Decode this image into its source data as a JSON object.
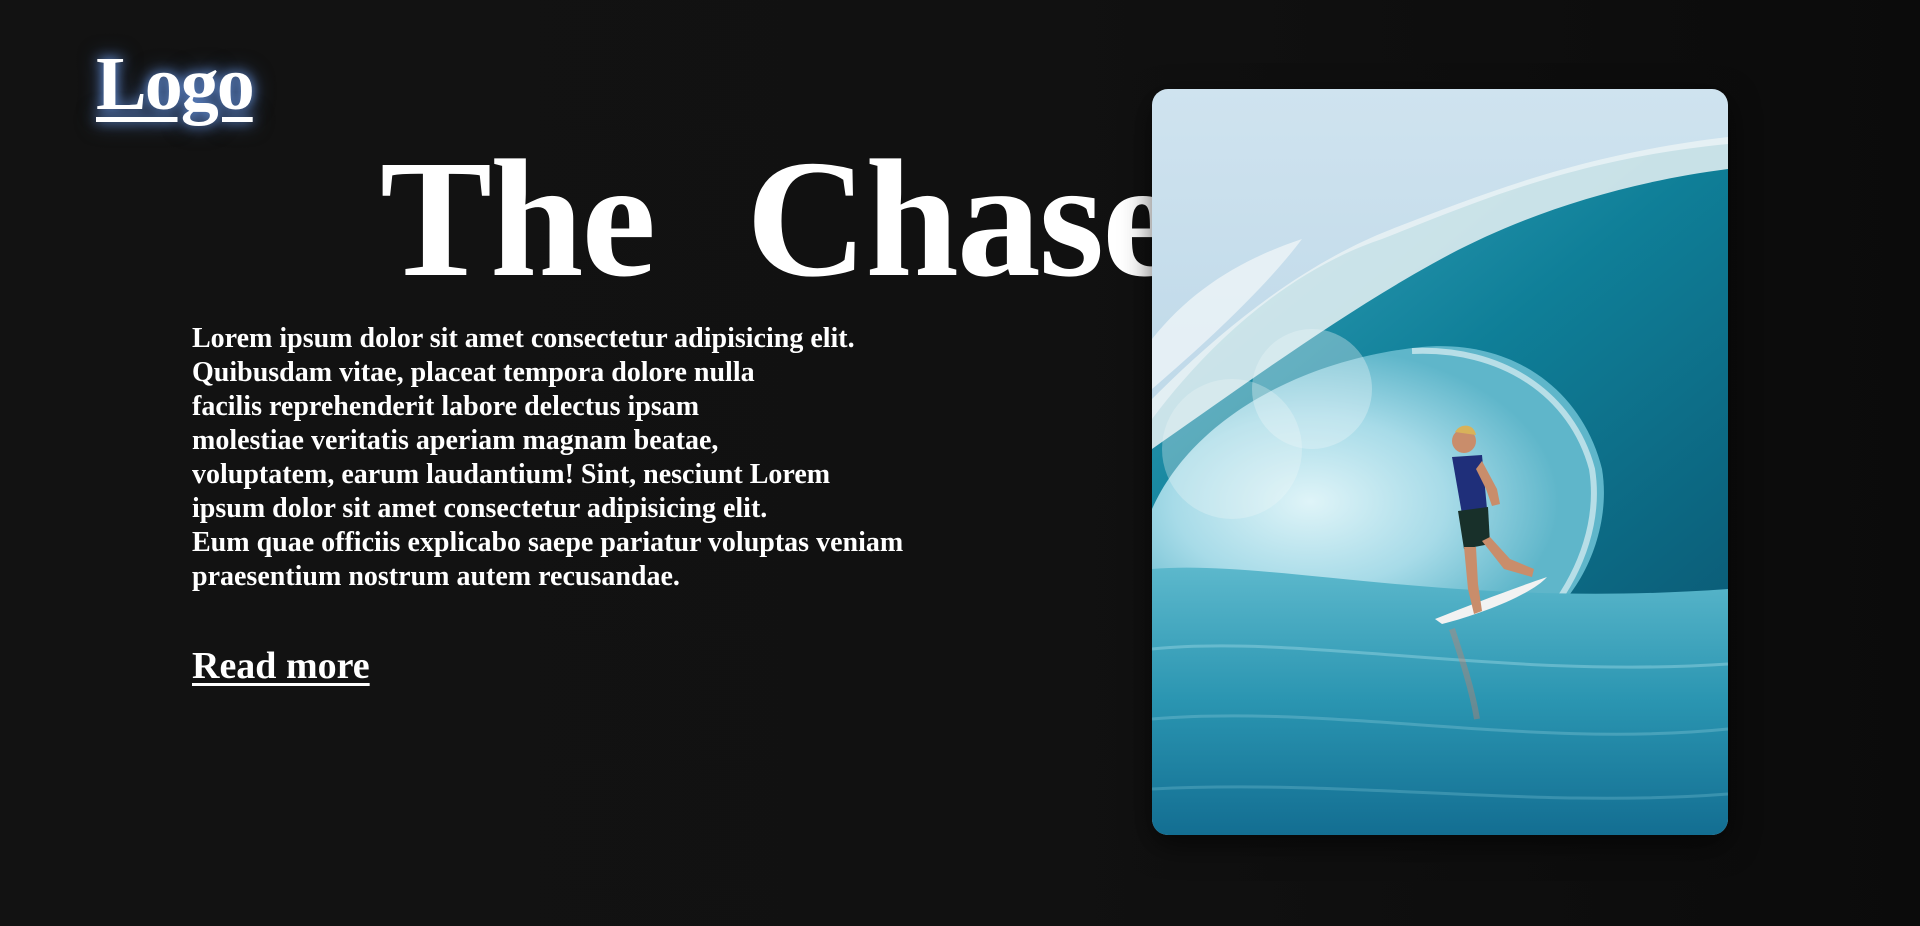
{
  "header": {
    "logo_text": "Logo"
  },
  "hero": {
    "title_words": [
      "The",
      "Chase"
    ],
    "paragraph_lines": [
      "Lorem ipsum dolor sit amet consectetur adipisicing elit.",
      "Quibusdam vitae, placeat tempora dolore nulla",
      "facilis reprehenderit labore delectus ipsam",
      "molestiae veritatis aperiam magnam beatae,",
      "voluptatem, earum laudantium! Sint, nesciunt Lorem",
      "ipsum dolor sit amet consectetur adipisicing elit.",
      "Eum quae officiis explicabo saepe pariatur voluptas veniam",
      "praesentium nostrum autem recusandae."
    ],
    "read_more_label": "Read more",
    "image_subject": "surfer-riding-barrel-wave"
  },
  "colors": {
    "background": "#111111",
    "text": "#ffffff",
    "logo_glow": "#78aaff",
    "wave_dark": "#0e6f86",
    "wave_light": "#9fe0ee"
  }
}
